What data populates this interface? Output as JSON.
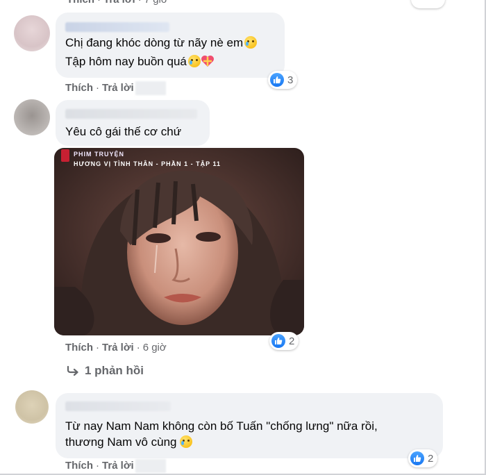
{
  "top_partial": {
    "like": "Thích",
    "reply": "Trả lời",
    "time": "7 giờ"
  },
  "comments": [
    {
      "lines": [
        "Chị đang khóc dòng từ nãy nè em",
        "Tập hôm nay buồn quá"
      ],
      "actions": {
        "like": "Thích",
        "reply": "Trả lời"
      },
      "reaction_count": "3"
    },
    {
      "lines": [
        "Yêu cô gái thế cơ chứ"
      ],
      "media": {
        "caption_top": "PHIM TRUYỆN",
        "caption": "HƯƠNG VỊ TÌNH THÂN - PHẦN 1 - TẬP 11"
      },
      "actions": {
        "like": "Thích",
        "reply": "Trả lời",
        "time": "6 giờ"
      },
      "reaction_count": "2",
      "replies_link": "1 phản hồi"
    },
    {
      "lines": [
        "Từ nay Nam Nam không còn bố Tuấn \"chống lưng\" nữa rồi,",
        "thương Nam vô cùng"
      ],
      "actions": {
        "like": "Thích",
        "reply": "Trả lời"
      },
      "reaction_count": "2"
    }
  ],
  "colors": {
    "bubble": "#f0f2f5",
    "meta": "#65676b",
    "like_blue": "#1877f2"
  },
  "icons": [
    "like-icon",
    "crying-face-emoji",
    "heart-ribbon-emoji",
    "reply-arrow-icon"
  ]
}
